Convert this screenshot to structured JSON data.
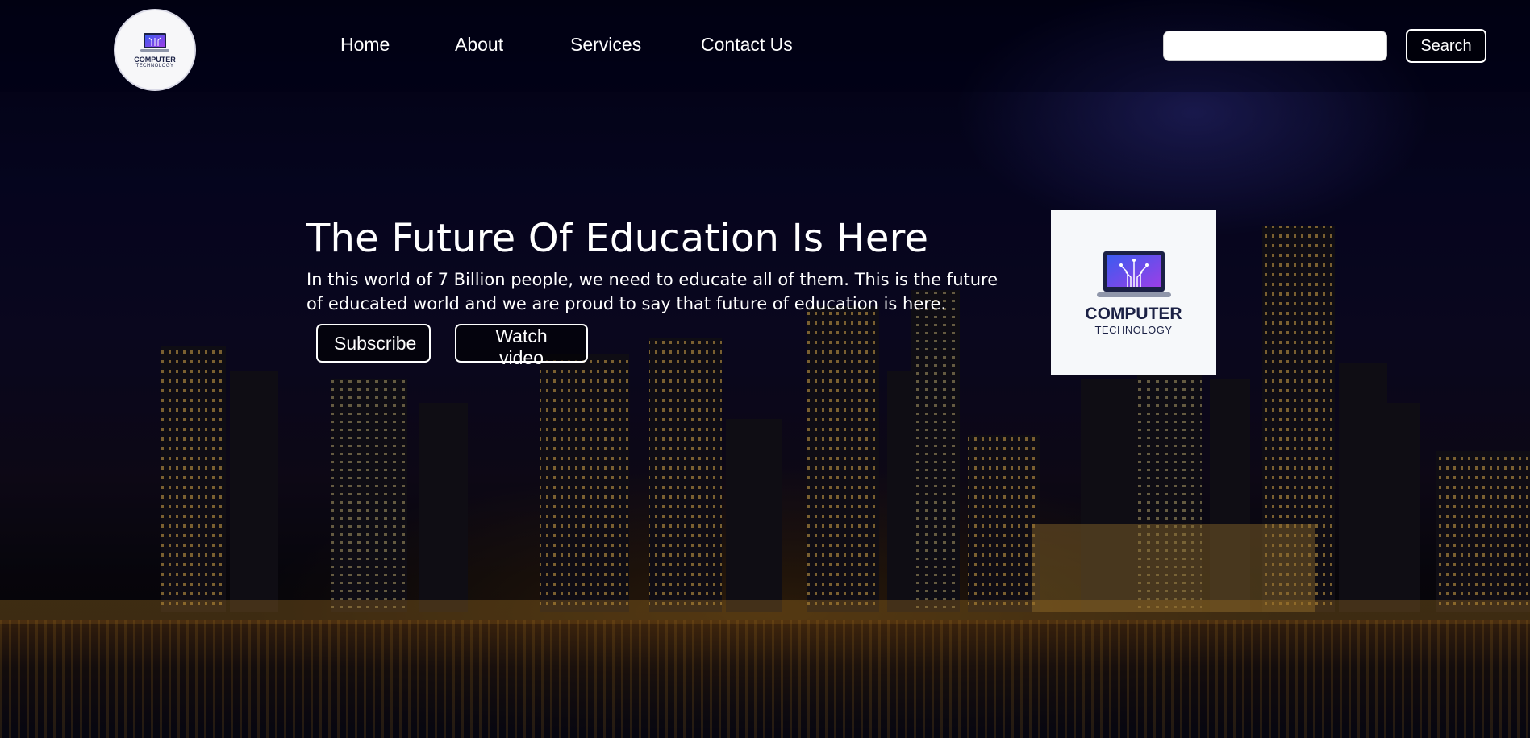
{
  "nav": {
    "links": [
      "Home",
      "About",
      "Services",
      "Contact Us"
    ],
    "search_value": "",
    "search_button": "Search"
  },
  "logo": {
    "line1": "COMPUTER",
    "line2": "TECHNOLOGY"
  },
  "hero": {
    "title": "The Future Of Education Is Here",
    "text": "In this world of 7 Billion people, we need to educate all of them. This is the future of educated world and we are proud to say that future of education is here.",
    "buttons": [
      "Subscribe",
      "Watch video"
    ]
  },
  "colors": {
    "brand_dark": "#1b2145",
    "laptop_screen_start": "#3b5bf0",
    "laptop_screen_end": "#9b3fe6"
  }
}
